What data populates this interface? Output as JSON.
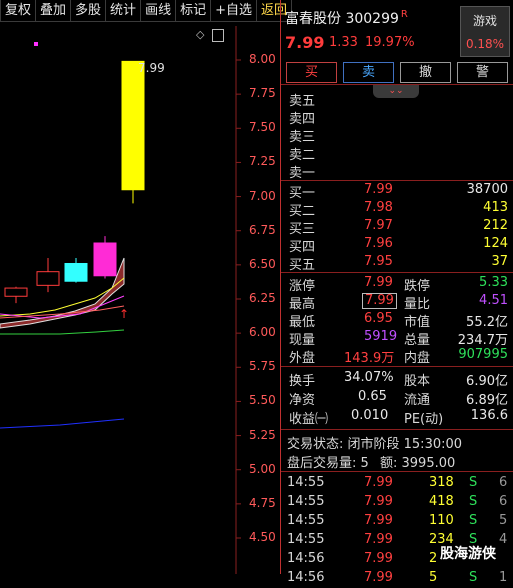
{
  "toolbar": [
    {
      "label": "复权"
    },
    {
      "label": "叠加"
    },
    {
      "label": "多股"
    },
    {
      "label": "统计"
    },
    {
      "label": "画线"
    },
    {
      "label": "标记"
    },
    {
      "label": "+自选"
    },
    {
      "label": "返回"
    }
  ],
  "chart": {
    "price_label": "7.99",
    "y_ticks": [
      "8.00",
      "7.75",
      "7.50",
      "7.25",
      "7.00",
      "6.75",
      "6.50",
      "6.25",
      "6.00",
      "5.75",
      "5.50",
      "5.25",
      "5.00",
      "4.75",
      "4.50"
    ]
  },
  "chart_data": {
    "type": "candlestick",
    "y_range": [
      4.4,
      8.05
    ],
    "candles": [
      {
        "open": 6.27,
        "close": 6.33,
        "high": 6.34,
        "low": 6.22,
        "color": "#ff3c3c",
        "fill": "hollow"
      },
      {
        "open": 6.35,
        "close": 6.45,
        "high": 6.55,
        "low": 6.3,
        "color": "#ff3c3c",
        "fill": "hollow"
      },
      {
        "open": 6.38,
        "close": 6.51,
        "high": 6.55,
        "low": 6.37,
        "color": "#33ffff",
        "fill": "solid"
      },
      {
        "open": 6.42,
        "close": 6.66,
        "high": 6.71,
        "low": 6.4,
        "color": "#ff2bd6",
        "fill": "solid"
      },
      {
        "open": 7.05,
        "close": 7.99,
        "high": 7.99,
        "low": 6.95,
        "color": "#ffff00",
        "fill": "solid"
      }
    ]
  },
  "stock": {
    "name": "富春股份",
    "code": "300299",
    "badge": "R",
    "price": "7.99",
    "change": "1.33",
    "pct": "19.97%",
    "game_label": "游戏",
    "game_pct": "0.18%"
  },
  "buttons": {
    "buy": "买",
    "sell": "卖",
    "cancel": "撤",
    "alert": "警"
  },
  "sell_levels": [
    {
      "label": "卖五"
    },
    {
      "label": "卖四"
    },
    {
      "label": "卖三"
    },
    {
      "label": "卖二"
    },
    {
      "label": "卖一"
    }
  ],
  "buy_levels": [
    {
      "label": "买一",
      "price": "7.99",
      "vol": "38700"
    },
    {
      "label": "买二",
      "price": "7.98",
      "vol": "413"
    },
    {
      "label": "买三",
      "price": "7.97",
      "vol": "212"
    },
    {
      "label": "买四",
      "price": "7.96",
      "vol": "124"
    },
    {
      "label": "买五",
      "price": "7.95",
      "vol": "37"
    }
  ],
  "stats": {
    "zt_label": "涨停",
    "zt": "7.99",
    "dt_label": "跌停",
    "dt": "5.33",
    "high_label": "最高",
    "high": "7.99",
    "lb_label": "量比",
    "lb": "4.51",
    "low_label": "最低",
    "low": "6.95",
    "sz_label": "市值",
    "sz": "55.2亿",
    "xl_label": "现量",
    "xl": "5919",
    "zl_label": "总量",
    "zl": "234.7万",
    "wp_label": "外盘",
    "wp": "143.9万",
    "np_label": "内盘",
    "np": "907995"
  },
  "fund": {
    "hs_label": "换手",
    "hs": "34.07%",
    "gb_label": "股本",
    "gb": "6.90亿",
    "jz_label": "净资",
    "jz": "0.65",
    "lt_label": "流通",
    "lt": "6.89亿",
    "sy_label": "收益㈠",
    "sy": "0.010",
    "pe_label": "PE(动)",
    "pe": "136.6"
  },
  "status": {
    "state": "交易状态: 闭市阶段 15:30:00",
    "after_label": "盘后交易量: 5",
    "after_amt_label": "额: 3995.00"
  },
  "ticks": [
    {
      "time": "14:55",
      "price": "7.99",
      "vol": "318",
      "side": "S",
      "n": "6"
    },
    {
      "time": "14:55",
      "price": "7.99",
      "vol": "418",
      "side": "S",
      "n": "6"
    },
    {
      "time": "14:55",
      "price": "7.99",
      "vol": "110",
      "side": "S",
      "n": "5"
    },
    {
      "time": "14:55",
      "price": "7.99",
      "vol": "234",
      "side": "S",
      "n": "4"
    },
    {
      "time": "14:56",
      "price": "7.99",
      "vol": "2",
      "side": "",
      "n": ""
    },
    {
      "time": "14:56",
      "price": "7.99",
      "vol": "5",
      "side": "S",
      "n": "1"
    }
  ],
  "watermark": "股海游侠"
}
